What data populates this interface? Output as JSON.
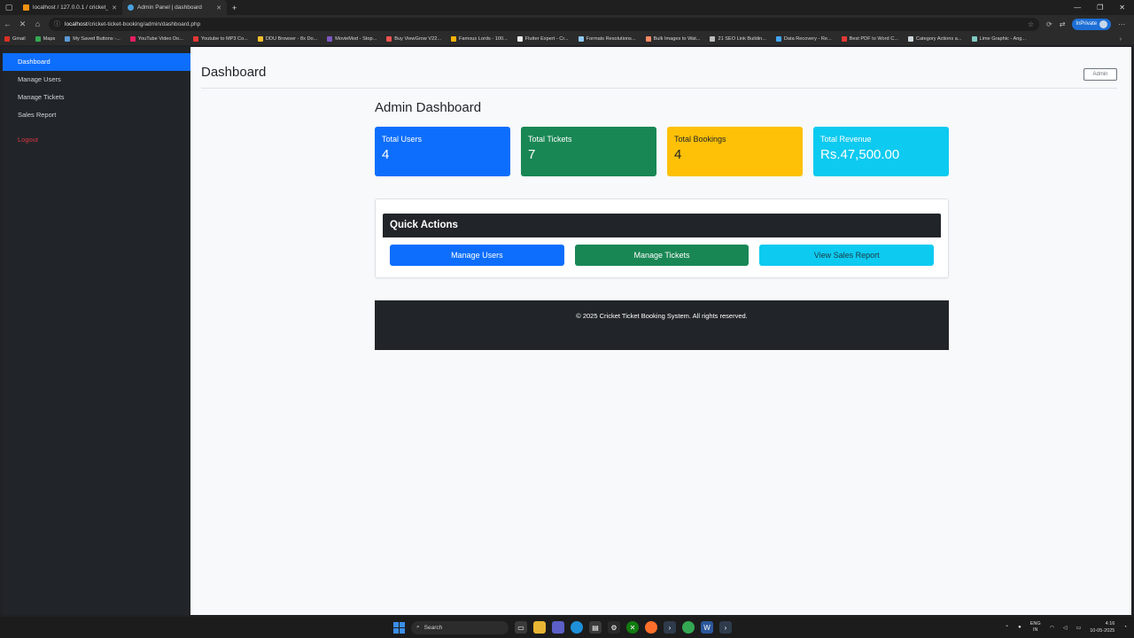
{
  "browser": {
    "tabs": [
      {
        "title": "localhost / 127.0.0.1 / cricket_bo...",
        "favicon_color": "#f29111"
      },
      {
        "title": "Admin Panel | dashboard",
        "favicon_color": "#4aa3df"
      }
    ],
    "new_tab": "+",
    "url_host": "localhost",
    "url_path": "/cricket-ticket-booking/admin/dashboard.php",
    "inprivate_label": "InPrivate",
    "bookmarks": [
      {
        "label": "Gmail",
        "color": "#d93025"
      },
      {
        "label": "Maps",
        "color": "#34a853"
      },
      {
        "label": "My Saved Buttons -...",
        "color": "#5b9bd5"
      },
      {
        "label": "YouTube Video Do...",
        "color": "#e91e63"
      },
      {
        "label": "Youtube to MP3 Co...",
        "color": "#e53935"
      },
      {
        "label": "DDU Browser - 8x Do...",
        "color": "#fbc02d"
      },
      {
        "label": "MovieMod - Stop...",
        "color": "#7e57c2"
      },
      {
        "label": "Buy ViewGrow V22...",
        "color": "#ef5350"
      },
      {
        "label": "Famous Lords - 100...",
        "color": "#ffb300"
      },
      {
        "label": "Flutter Expert - Cr...",
        "color": "#eeeeee"
      },
      {
        "label": "Formats Resolutions...",
        "color": "#90caf9"
      },
      {
        "label": "Bulk Images to Wat...",
        "color": "#ff8a65"
      },
      {
        "label": "21 SEO Link Buildin...",
        "color": "#bdbdbd"
      },
      {
        "label": "Data Recovery - Re...",
        "color": "#42a5f5"
      },
      {
        "label": "Best PDF to Word C...",
        "color": "#e53935"
      },
      {
        "label": "Category Actions a...",
        "color": "#cfd8dc"
      },
      {
        "label": "Lime Graphic - Ang...",
        "color": "#80cbc4"
      }
    ]
  },
  "sidebar": {
    "items": [
      {
        "label": "Dashboard"
      },
      {
        "label": "Manage Users"
      },
      {
        "label": "Manage Tickets"
      },
      {
        "label": "Sales Report"
      }
    ],
    "logout": "Logout"
  },
  "topbar": {
    "title": "Dashboard",
    "admin_button": "Admin"
  },
  "content": {
    "title": "Admin Dashboard",
    "stats": [
      {
        "label": "Total Users",
        "value": "4",
        "color": "#0d6efd"
      },
      {
        "label": "Total Tickets",
        "value": "7",
        "color": "#198754"
      },
      {
        "label": "Total Bookings",
        "value": "4",
        "color": "#ffc107"
      },
      {
        "label": "Total Revenue",
        "value": "Rs.47,500.00",
        "color": "#0dcaf0"
      }
    ],
    "quick_actions": {
      "title": "Quick Actions",
      "buttons": [
        {
          "label": "Manage Users",
          "color": "#0d6efd"
        },
        {
          "label": "Manage Tickets",
          "color": "#198754"
        },
        {
          "label": "View Sales Report",
          "color": "#0dcaf0"
        }
      ]
    },
    "footer": "© 2025 Cricket Ticket Booking System. All rights reserved."
  },
  "taskbar": {
    "search_placeholder": "Search",
    "lang_top": "ENG",
    "lang_bottom": "IN",
    "time": "4:16",
    "date": "10-05-2025"
  }
}
